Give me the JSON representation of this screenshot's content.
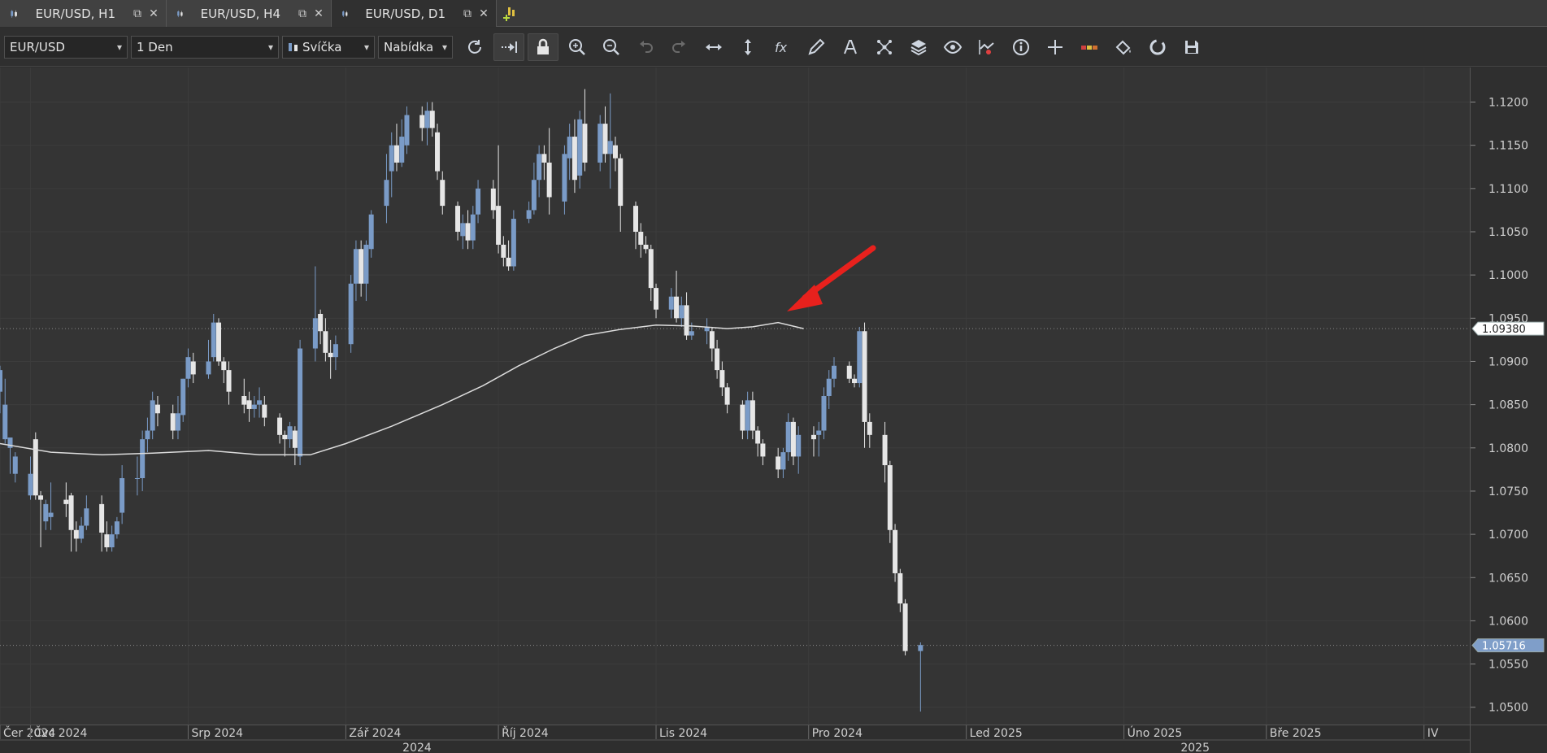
{
  "tabs": [
    {
      "label": "EUR/USD, H1",
      "active": false
    },
    {
      "label": "EUR/USD, H4",
      "active": false
    },
    {
      "label": "EUR/USD, D1",
      "active": true
    }
  ],
  "toolbar": {
    "instrument": "EUR/USD",
    "period": "1 Den",
    "chart_type": "Svíčka",
    "price_type": "Nabídka"
  },
  "icons": {
    "tab": "candlestick-icon",
    "popout": "popout-icon",
    "close": "close-icon",
    "new_tab": "add-chart-icon",
    "tools": [
      "refresh-icon",
      "auto-shift-icon",
      "lock-icon",
      "zoom-in-icon",
      "zoom-out-icon",
      "undo-icon",
      "redo-icon",
      "horizontal-scale-icon",
      "vertical-scale-icon",
      "indicators-icon",
      "drawing-icon",
      "text-icon",
      "pattern-icon",
      "layers-icon",
      "view-icon",
      "signals-icon",
      "info-icon",
      "crosshair-icon",
      "theme-icon",
      "paint-icon",
      "reset-icon",
      "save-icon"
    ]
  },
  "colors": {
    "bull": "#7a9bc7",
    "bear": "#e6e6e6",
    "ma_line": "#dcdcdc",
    "arrow": "#e8211d",
    "price_badge_current": "#7f9ec9",
    "price_badge_ma": "#ffffff"
  },
  "chart_data": {
    "type": "candlestick",
    "instrument": "EUR/USD",
    "period": "D1",
    "y_ticks": [
      "1.0500",
      "1.0550",
      "1.0600",
      "1.0650",
      "1.0700",
      "1.0750",
      "1.0800",
      "1.0850",
      "1.0900",
      "1.0950",
      "1.1000",
      "1.1050",
      "1.1100",
      "1.1150",
      "1.1200"
    ],
    "ylim": [
      1.048,
      1.124
    ],
    "x_labels": [
      {
        "label": "Čer 2024",
        "date": "2024-06-25"
      },
      {
        "label": "Čvc 2024",
        "date": "2024-07-01"
      },
      {
        "label": "Srp 2024",
        "date": "2024-08-01"
      },
      {
        "label": "Zář 2024",
        "date": "2024-09-01"
      },
      {
        "label": "Říj 2024",
        "date": "2024-10-01"
      },
      {
        "label": "Lis 2024",
        "date": "2024-11-01"
      },
      {
        "label": "Pro 2024",
        "date": "2024-12-01"
      },
      {
        "label": "Led 2025",
        "date": "2025-01-01"
      },
      {
        "label": "Úno 2025",
        "date": "2025-02-01"
      },
      {
        "label": "Bře 2025",
        "date": "2025-03-01"
      },
      {
        "label": "IV",
        "date": "2025-04-01"
      }
    ],
    "year_labels": [
      {
        "label": "2024",
        "date": "2024-09-15"
      },
      {
        "label": "2025",
        "date": "2025-02-15"
      }
    ],
    "x_range": [
      "2024-06-25",
      "2025-04-10"
    ],
    "candles_start_date": "2024-06-25",
    "candles": [
      [
        1.0865,
        1.089,
        1.084,
        1.0895
      ],
      [
        1.081,
        1.085,
        1.0805,
        1.088
      ],
      [
        1.08,
        1.0812,
        1.077,
        1.081
      ],
      [
        1.077,
        1.079,
        1.076,
        1.0795
      ],
      [
        1.0745,
        1.077,
        1.074,
        1.079
      ],
      [
        1.081,
        1.0745,
        1.074,
        1.0818
      ],
      [
        1.0745,
        1.074,
        1.0685,
        1.075
      ],
      [
        1.0715,
        1.0735,
        1.0705,
        1.074
      ],
      [
        1.072,
        1.0725,
        1.0705,
        1.076
      ],
      [
        1.074,
        1.0735,
        1.072,
        1.076
      ],
      [
        1.0745,
        1.0705,
        1.068,
        1.0748
      ],
      [
        1.0705,
        1.0695,
        1.068,
        1.0715
      ],
      [
        1.0695,
        1.071,
        1.069,
        1.072
      ],
      [
        1.071,
        1.073,
        1.0705,
        1.0745
      ],
      [
        1.0735,
        1.0702,
        1.068,
        1.0745
      ],
      [
        1.07,
        1.0685,
        1.068,
        1.0715
      ],
      [
        1.0685,
        1.07,
        1.068,
        1.071
      ],
      [
        1.07,
        1.0715,
        1.0695,
        1.072
      ],
      [
        1.0725,
        1.0765,
        1.0712,
        1.078
      ],
      [
        1.0765,
        1.0765,
        1.0745,
        1.079
      ],
      [
        1.0765,
        1.081,
        1.075,
        1.082
      ],
      [
        1.081,
        1.082,
        1.0795,
        1.0835
      ],
      [
        1.082,
        1.0855,
        1.081,
        1.0865
      ],
      [
        1.085,
        1.084,
        1.0825,
        1.086
      ],
      [
        1.084,
        1.082,
        1.081,
        1.085
      ],
      [
        1.082,
        1.084,
        1.081,
        1.086
      ],
      [
        1.0838,
        1.088,
        1.083,
        1.088
      ],
      [
        1.088,
        1.0905,
        1.087,
        1.0915
      ],
      [
        1.09,
        1.0885,
        1.0875,
        1.091
      ],
      [
        1.0885,
        1.09,
        1.088,
        1.0925
      ],
      [
        1.0905,
        1.0945,
        1.09,
        1.0955
      ],
      [
        1.0945,
        1.09,
        1.0895,
        1.095
      ],
      [
        1.09,
        1.089,
        1.0875,
        1.0905
      ],
      [
        1.089,
        1.0865,
        1.085,
        1.09
      ],
      [
        1.086,
        1.085,
        1.084,
        1.088
      ],
      [
        1.0855,
        1.0845,
        1.083,
        1.0865
      ],
      [
        1.0845,
        1.085,
        1.0835,
        1.086
      ],
      [
        1.085,
        1.0855,
        1.0835,
        1.087
      ],
      [
        1.085,
        1.0835,
        1.0825,
        1.086
      ],
      [
        1.0835,
        1.0815,
        1.0805,
        1.084
      ],
      [
        1.0815,
        1.081,
        1.079,
        1.082
      ],
      [
        1.081,
        1.0825,
        1.08,
        1.083
      ],
      [
        1.082,
        1.08,
        1.078,
        1.0825
      ],
      [
        1.079,
        1.0915,
        1.078,
        1.0925
      ],
      [
        1.0915,
        1.095,
        1.09,
        1.101
      ],
      [
        1.0955,
        1.0935,
        1.092,
        1.096
      ],
      [
        1.0935,
        1.091,
        1.09,
        1.095
      ],
      [
        1.091,
        1.0905,
        1.088,
        1.0925
      ],
      [
        1.0905,
        1.092,
        1.089,
        1.093
      ],
      [
        1.092,
        1.099,
        1.091,
        1.1
      ],
      [
        1.099,
        1.103,
        1.097,
        1.104
      ],
      [
        1.103,
        1.099,
        1.0975,
        1.104
      ],
      [
        1.099,
        1.1035,
        1.097,
        1.104
      ],
      [
        1.103,
        1.107,
        1.102,
        1.1075
      ],
      [
        1.108,
        1.111,
        1.106,
        1.114
      ],
      [
        1.112,
        1.115,
        1.109,
        1.1165
      ],
      [
        1.115,
        1.113,
        1.112,
        1.1175
      ],
      [
        1.113,
        1.116,
        1.1125,
        1.118
      ],
      [
        1.115,
        1.1185,
        1.114,
        1.1195
      ],
      [
        1.1185,
        1.117,
        1.1155,
        1.1195
      ],
      [
        1.117,
        1.119,
        1.115,
        1.12
      ],
      [
        1.119,
        1.117,
        1.116,
        1.12
      ],
      [
        1.1165,
        1.112,
        1.111,
        1.1175
      ],
      [
        1.111,
        1.108,
        1.107,
        1.112
      ],
      [
        1.108,
        1.105,
        1.104,
        1.1085
      ],
      [
        1.1045,
        1.106,
        1.103,
        1.107
      ],
      [
        1.106,
        1.104,
        1.103,
        1.1075
      ],
      [
        1.104,
        1.107,
        1.103,
        1.108
      ],
      [
        1.107,
        1.11,
        1.106,
        1.111
      ],
      [
        1.11,
        1.1075,
        1.1065,
        1.111
      ],
      [
        1.108,
        1.1035,
        1.1025,
        1.115
      ],
      [
        1.1035,
        1.102,
        1.101,
        1.1045
      ],
      [
        1.102,
        1.101,
        1.1005,
        1.104
      ],
      [
        1.101,
        1.1065,
        1.1005,
        1.1075
      ],
      [
        1.1065,
        1.1075,
        1.106,
        1.1085
      ],
      [
        1.1075,
        1.111,
        1.107,
        1.113
      ],
      [
        1.111,
        1.114,
        1.109,
        1.115
      ],
      [
        1.114,
        1.113,
        1.111,
        1.115
      ],
      [
        1.113,
        1.109,
        1.107,
        1.117
      ],
      [
        1.1085,
        1.114,
        1.107,
        1.115
      ],
      [
        1.1135,
        1.116,
        1.111,
        1.1175
      ],
      [
        1.116,
        1.111,
        1.1095,
        1.118
      ],
      [
        1.1115,
        1.118,
        1.11,
        1.119
      ],
      [
        1.1175,
        1.113,
        1.112,
        1.1215
      ],
      [
        1.113,
        1.1175,
        1.112,
        1.1185
      ],
      [
        1.1175,
        1.114,
        1.113,
        1.1195
      ],
      [
        1.114,
        1.1155,
        1.11,
        1.121
      ],
      [
        1.115,
        1.1135,
        1.112,
        1.116
      ],
      [
        1.1135,
        1.108,
        1.105,
        1.114
      ],
      [
        1.108,
        1.105,
        1.103,
        1.1085
      ],
      [
        1.105,
        1.1035,
        1.102,
        1.106
      ],
      [
        1.1035,
        1.103,
        1.1025,
        1.1045
      ],
      [
        1.103,
        1.0985,
        1.097,
        1.1035
      ],
      [
        1.0985,
        1.096,
        1.095,
        1.099
      ],
      [
        1.096,
        1.0975,
        1.095,
        1.0985
      ],
      [
        1.0975,
        1.095,
        1.0945,
        1.1005
      ],
      [
        1.095,
        1.0965,
        1.094,
        1.0975
      ],
      [
        1.0965,
        1.093,
        1.0925,
        1.098
      ],
      [
        1.093,
        1.0935,
        1.0925,
        1.0945
      ],
      [
        1.0935,
        1.094,
        1.092,
        1.095
      ],
      [
        1.0935,
        1.0915,
        1.09,
        1.094
      ],
      [
        1.0915,
        1.089,
        1.088,
        1.0925
      ],
      [
        1.089,
        1.087,
        1.086,
        1.09
      ],
      [
        1.087,
        1.085,
        1.084,
        1.0875
      ],
      [
        1.085,
        1.082,
        1.081,
        1.0855
      ],
      [
        1.082,
        1.0855,
        1.081,
        1.0865
      ],
      [
        1.0855,
        1.082,
        1.081,
        1.0865
      ],
      [
        1.082,
        1.0805,
        1.079,
        1.0825
      ],
      [
        1.0805,
        1.079,
        1.078,
        1.081
      ],
      [
        1.079,
        1.0775,
        1.0765,
        1.08
      ],
      [
        1.0775,
        1.0795,
        1.0765,
        1.08
      ],
      [
        1.0795,
        1.083,
        1.0785,
        1.084
      ],
      [
        1.083,
        1.079,
        1.078,
        1.0835
      ],
      [
        1.079,
        1.0815,
        1.077,
        1.0825
      ],
      [
        1.0815,
        1.081,
        1.079,
        1.0825
      ],
      [
        1.0815,
        1.082,
        1.079,
        1.083
      ],
      [
        1.082,
        1.086,
        1.081,
        1.087
      ],
      [
        1.086,
        1.088,
        1.0845,
        1.089
      ],
      [
        1.088,
        1.0895,
        1.087,
        1.0905
      ],
      [
        1.0895,
        1.088,
        1.0875,
        1.09
      ],
      [
        1.088,
        1.0875,
        1.087,
        1.0885
      ],
      [
        1.0875,
        1.0935,
        1.087,
        1.094
      ],
      [
        1.0935,
        1.083,
        1.08,
        1.0945
      ],
      [
        1.083,
        1.0815,
        1.08,
        1.084
      ],
      [
        1.0815,
        1.078,
        1.076,
        1.083
      ],
      [
        1.078,
        1.0705,
        1.069,
        1.0785
      ],
      [
        1.0705,
        1.0655,
        1.0645,
        1.0712
      ],
      [
        1.0655,
        1.062,
        1.061,
        1.066
      ],
      [
        1.062,
        1.0565,
        1.056,
        1.0625
      ],
      [
        1.0565,
        1.0572,
        1.0495,
        1.0575
      ]
    ],
    "moving_average": [
      [
        "2024-06-25",
        1.0805
      ],
      [
        "2024-07-05",
        1.0795
      ],
      [
        "2024-07-15",
        1.0792
      ],
      [
        "2024-07-25",
        1.0794
      ],
      [
        "2024-08-05",
        1.0797
      ],
      [
        "2024-08-15",
        1.0792
      ],
      [
        "2024-08-25",
        1.0792
      ],
      [
        "2024-09-01",
        1.0805
      ],
      [
        "2024-09-10",
        1.0825
      ],
      [
        "2024-09-20",
        1.085
      ],
      [
        "2024-09-28",
        1.0872
      ],
      [
        "2024-10-05",
        1.0895
      ],
      [
        "2024-10-12",
        1.0915
      ],
      [
        "2024-10-18",
        1.093
      ],
      [
        "2024-10-25",
        1.0937
      ],
      [
        "2024-11-01",
        1.0942
      ],
      [
        "2024-11-08",
        1.0941
      ],
      [
        "2024-11-15",
        1.0938
      ],
      [
        "2024-11-20",
        1.094
      ],
      [
        "2024-11-25",
        1.0945
      ],
      [
        "2024-11-30",
        1.0938
      ]
    ],
    "price_badges": [
      "1.09380",
      "1.05716"
    ],
    "price_badges_values": [
      1.0938,
      1.05716
    ]
  }
}
